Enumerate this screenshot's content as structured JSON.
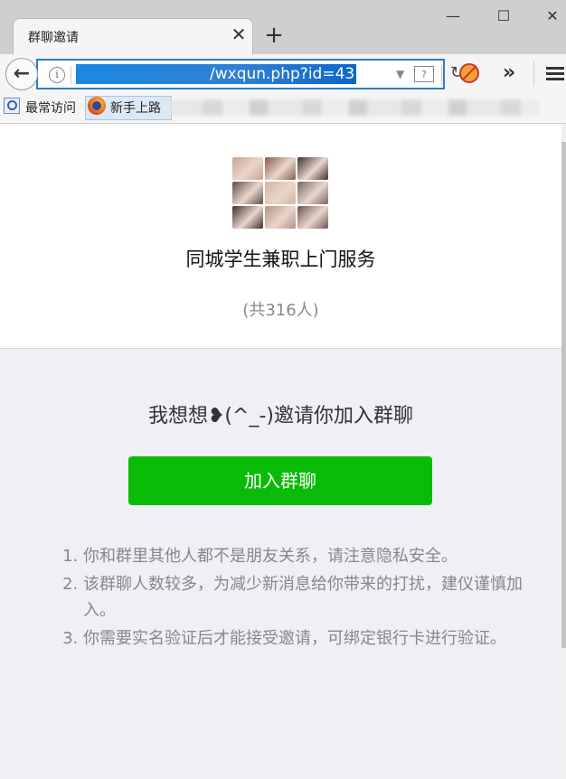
{
  "browser": {
    "tab_title": "群聊邀请",
    "url": "/wxqun.php?id=43",
    "bookmarks": [
      {
        "label": "最常访问",
        "icon": "bookmark-search-icon"
      },
      {
        "label": "新手上路",
        "icon": "firefox-icon"
      }
    ],
    "colors": {
      "url_highlight": "#1a88e0",
      "focus_border": "#2a7bd5"
    }
  },
  "group": {
    "name": "同城学生兼职上门服务",
    "member_count": "(共316人)",
    "avatar_colors": [
      "#c9a48f",
      "#8a5a52",
      "#3b3030",
      "#5d4a47",
      "#d7b3a0",
      "#7a6661",
      "#3c2f2e",
      "#b98f83",
      "#6e5350"
    ]
  },
  "invite": {
    "text": "我想想❥(^_-)邀请你加入群聊",
    "join_button": "加入群聊",
    "button_color": "#09bb07"
  },
  "notices": [
    "你和群里其他人都不是朋友关系，请注意隐私安全。",
    "该群聊人数较多，为减少新消息给你带来的打扰，建仪谨慎加入。",
    "你需要实名验证后才能接受邀请，可绑定银行卡进行验证。"
  ]
}
